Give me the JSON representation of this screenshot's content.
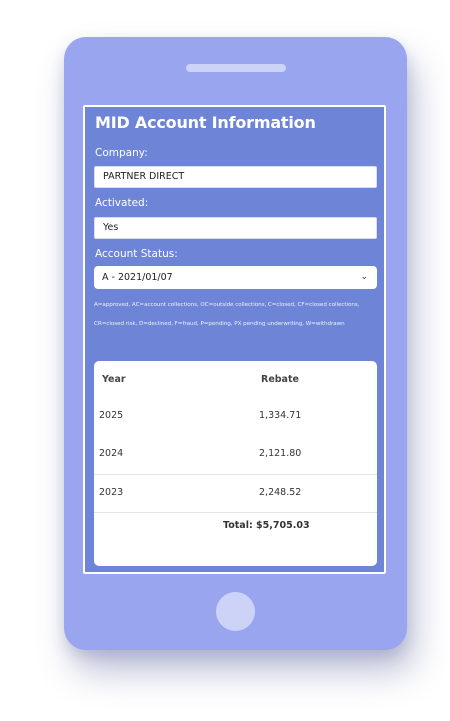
{
  "page": {
    "title": "MID Account Information"
  },
  "fields": {
    "company_label": "Company:",
    "company_value": "PARTNER DIRECT",
    "activated_label": "Activated:",
    "activated_value": "Yes",
    "status_label": "Account Status:",
    "status_selected": "A - 2021/01/07"
  },
  "legend": {
    "line1": "A=approved, AC=account collections, OC=outside collections, C=closed, CF=closed collections,",
    "line2": "CR=closed risk, D=declined, F=fraud, P=pending, PX pending underwriting, W=withdrawn"
  },
  "rebates": {
    "headers": {
      "year": "Year",
      "rebate": "Rebate"
    },
    "rows": [
      {
        "year": "2025",
        "rebate": "1,334.71"
      },
      {
        "year": "2024",
        "rebate": "2,121.80"
      },
      {
        "year": "2023",
        "rebate": "2,248.52"
      }
    ],
    "total": "Total: $5,705.03"
  },
  "icons": {
    "select_chevron": "chevron-down-icon"
  },
  "colors": {
    "phone_body": "#99a6ef",
    "screen_background": "#6d84d7",
    "card_background": "#ffffff"
  }
}
